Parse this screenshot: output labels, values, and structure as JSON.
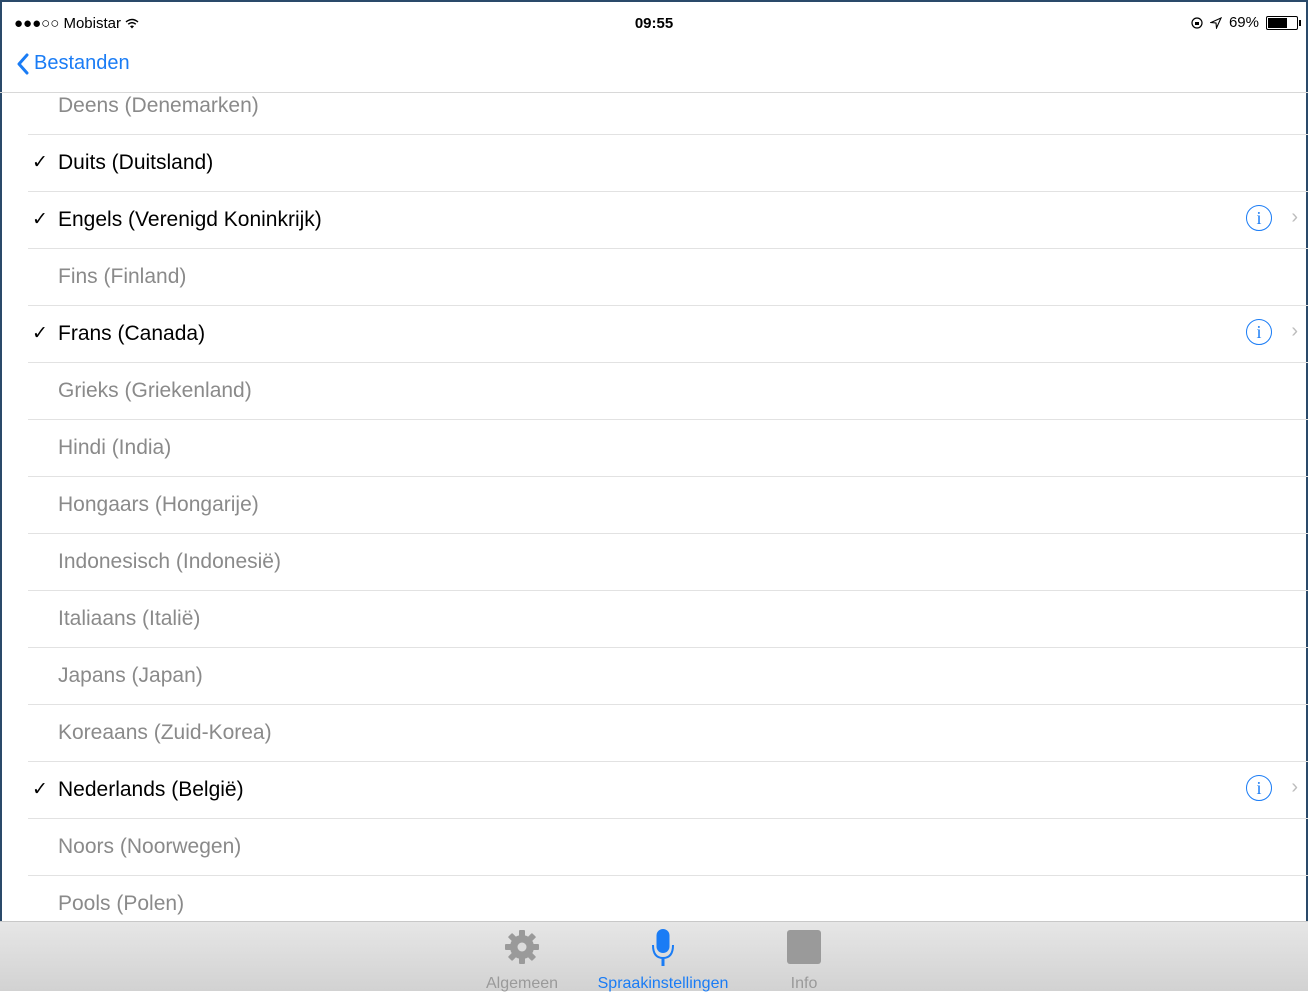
{
  "status_bar": {
    "carrier": "●●●○○ Mobistar",
    "time": "09:55",
    "battery": "69%",
    "battery_level": 0.69
  },
  "nav": {
    "back_label": "Bestanden"
  },
  "languages": [
    {
      "label": "Deens (Denemarken)",
      "selected": false,
      "info": false
    },
    {
      "label": "Duits (Duitsland)",
      "selected": true,
      "info": false
    },
    {
      "label": "Engels (Verenigd Koninkrijk)",
      "selected": true,
      "info": true
    },
    {
      "label": "Fins (Finland)",
      "selected": false,
      "info": false
    },
    {
      "label": "Frans (Canada)",
      "selected": true,
      "info": true
    },
    {
      "label": "Grieks (Griekenland)",
      "selected": false,
      "info": false
    },
    {
      "label": "Hindi (India)",
      "selected": false,
      "info": false
    },
    {
      "label": "Hongaars (Hongarije)",
      "selected": false,
      "info": false
    },
    {
      "label": "Indonesisch (Indonesië)",
      "selected": false,
      "info": false
    },
    {
      "label": "Italiaans (Italië)",
      "selected": false,
      "info": false
    },
    {
      "label": "Japans (Japan)",
      "selected": false,
      "info": false
    },
    {
      "label": "Koreaans (Zuid-Korea)",
      "selected": false,
      "info": false
    },
    {
      "label": "Nederlands (België)",
      "selected": true,
      "info": true
    },
    {
      "label": "Noors (Noorwegen)",
      "selected": false,
      "info": false
    },
    {
      "label": "Pools (Polen)",
      "selected": false,
      "info": false
    }
  ],
  "glyphs": {
    "check": "✓",
    "info": "i",
    "chevron": "›"
  },
  "tabs": [
    {
      "label": "Algemeen",
      "icon": "gear-icon"
    },
    {
      "label": "Spraakinstellingen",
      "icon": "microphone-icon"
    },
    {
      "label": "Info",
      "icon": "info-square-icon"
    }
  ],
  "colors": {
    "accent": "#1a7cf5",
    "selected_text": "#000000",
    "unselected_text": "#8a8a8a"
  }
}
